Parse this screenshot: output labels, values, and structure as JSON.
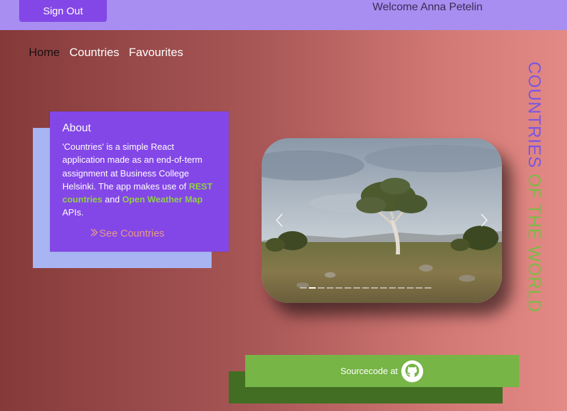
{
  "header": {
    "signout_label": "Sign Out",
    "welcome_text": "Welcome Anna Petelin"
  },
  "nav": {
    "items": [
      {
        "label": "Home",
        "active": true
      },
      {
        "label": "Countries",
        "active": false
      },
      {
        "label": "Favourites",
        "active": false
      }
    ]
  },
  "side_title": {
    "part1": "COUNTRIES ",
    "part2": "OF THE WORLD"
  },
  "about": {
    "title": "About",
    "text1": "'Countries' is a simple React application made as an end-of-term assignment at Business College Helsinki. The app makes use of ",
    "link1": "REST countries",
    "text2": " and ",
    "link2": "Open Weather Map",
    "text3": " APIs.",
    "cta": "See Countries"
  },
  "carousel": {
    "slide_count": 15,
    "active_index": 1,
    "prev_icon": "chevron-left-icon",
    "next_icon": "chevron-right-icon"
  },
  "source": {
    "label": "Sourcecode at",
    "icon": "github-icon"
  },
  "colors": {
    "topbar": "#a88ef0",
    "accent_purple": "#8447e7",
    "accent_green": "#76b546",
    "dark_green": "#426e23",
    "about_shadow": "#a9b5f3"
  }
}
